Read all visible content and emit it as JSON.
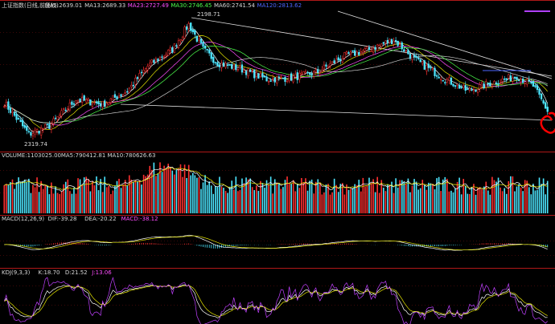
{
  "main_panel": {
    "header": [
      {
        "text": "上证指数(日线,前复权)",
        "color": "#d8d8d8"
      },
      {
        "text": "MA5:2639.01",
        "color": "#d8d8d8"
      },
      {
        "text": "MA13:2689.33",
        "color": "#d8d8d8"
      },
      {
        "text": "MA23:2727.49",
        "color": "#ff4dff"
      },
      {
        "text": "MA30:2746.45",
        "color": "#4dff4d"
      },
      {
        "text": "MA60:2741.54",
        "color": "#d8d8d8"
      },
      {
        "text": "MA120:2813.62",
        "color": "#4d66ff"
      }
    ],
    "high_label": "2198.71",
    "low_label": "2319.74"
  },
  "volume_panel": {
    "header": [
      {
        "text": "VOLUME:1103025.00",
        "color": "#d8d8d8"
      },
      {
        "text": "MA5:790412.81",
        "color": "#d8d8d8"
      },
      {
        "text": "MA10:780626.63",
        "color": "#d8d8d8"
      }
    ]
  },
  "macd_panel": {
    "header": [
      {
        "text": "MACD(12,26,9)",
        "color": "#d8d8d8"
      },
      {
        "text": "DIF:-39.28",
        "color": "#d8d8d8"
      },
      {
        "text": "DEA:-20.22",
        "color": "#d8d8d8"
      },
      {
        "text": "MACD:-38.12",
        "color": "#ff4dff"
      }
    ]
  },
  "kdj_panel": {
    "header": [
      {
        "text": "KDJ(9,3,3)",
        "color": "#d8d8d8"
      },
      {
        "text": "K:18.70",
        "color": "#d8d8d8"
      },
      {
        "text": "D:21.52",
        "color": "#d8d8d8"
      },
      {
        "text": "J:13.06",
        "color": "#ff4dff"
      }
    ]
  },
  "colors": {
    "up": "#ff3030",
    "down": "#4de6ff",
    "grid": "#7a1010",
    "axis": "#b01818",
    "trendline": "#e0e0e0",
    "highlight": "#ff0000"
  },
  "chart_data": [
    {
      "type": "candlestick",
      "title": "上证指数(日线,前复权)",
      "ma_lines": [
        "MA5",
        "MA13",
        "MA23",
        "MA30",
        "MA60",
        "MA120"
      ],
      "anchors": [
        {
          "x": 0,
          "close": 2580
        },
        {
          "x": 12,
          "close": 2390
        },
        {
          "x": 22,
          "close": 2440
        },
        {
          "x": 35,
          "close": 2600
        },
        {
          "x": 48,
          "close": 2570
        },
        {
          "x": 60,
          "close": 2650
        },
        {
          "x": 70,
          "close": 2800
        },
        {
          "x": 82,
          "close": 2900
        },
        {
          "x": 90,
          "close": 3050
        },
        {
          "x": 97,
          "close": 2900
        },
        {
          "x": 104,
          "close": 2820
        },
        {
          "x": 116,
          "close": 2780
        },
        {
          "x": 128,
          "close": 2720
        },
        {
          "x": 140,
          "close": 2730
        },
        {
          "x": 152,
          "close": 2760
        },
        {
          "x": 166,
          "close": 2860
        },
        {
          "x": 178,
          "close": 2900
        },
        {
          "x": 190,
          "close": 2960
        },
        {
          "x": 200,
          "close": 2840
        },
        {
          "x": 214,
          "close": 2730
        },
        {
          "x": 226,
          "close": 2650
        },
        {
          "x": 238,
          "close": 2700
        },
        {
          "x": 250,
          "close": 2740
        },
        {
          "x": 258,
          "close": 2680
        },
        {
          "x": 265,
          "close": 2530
        }
      ],
      "annotations": [
        "2198.71",
        "2319.74"
      ]
    },
    {
      "type": "bar",
      "title": "VOLUME",
      "series": [
        {
          "name": "VOLUME",
          "value": 1103025.0
        },
        {
          "name": "MA5",
          "value": 790412.81
        },
        {
          "name": "MA10",
          "value": 780626.63
        }
      ]
    },
    {
      "type": "bar",
      "title": "MACD(12,26,9)",
      "series": [
        {
          "name": "DIF",
          "value": -39.28
        },
        {
          "name": "DEA",
          "value": -20.22
        },
        {
          "name": "MACD",
          "value": -38.12
        }
      ]
    },
    {
      "type": "line",
      "title": "KDJ(9,3,3)",
      "series": [
        {
          "name": "K",
          "value": 18.7
        },
        {
          "name": "D",
          "value": 21.52
        },
        {
          "name": "J",
          "value": 13.06
        }
      ]
    }
  ]
}
